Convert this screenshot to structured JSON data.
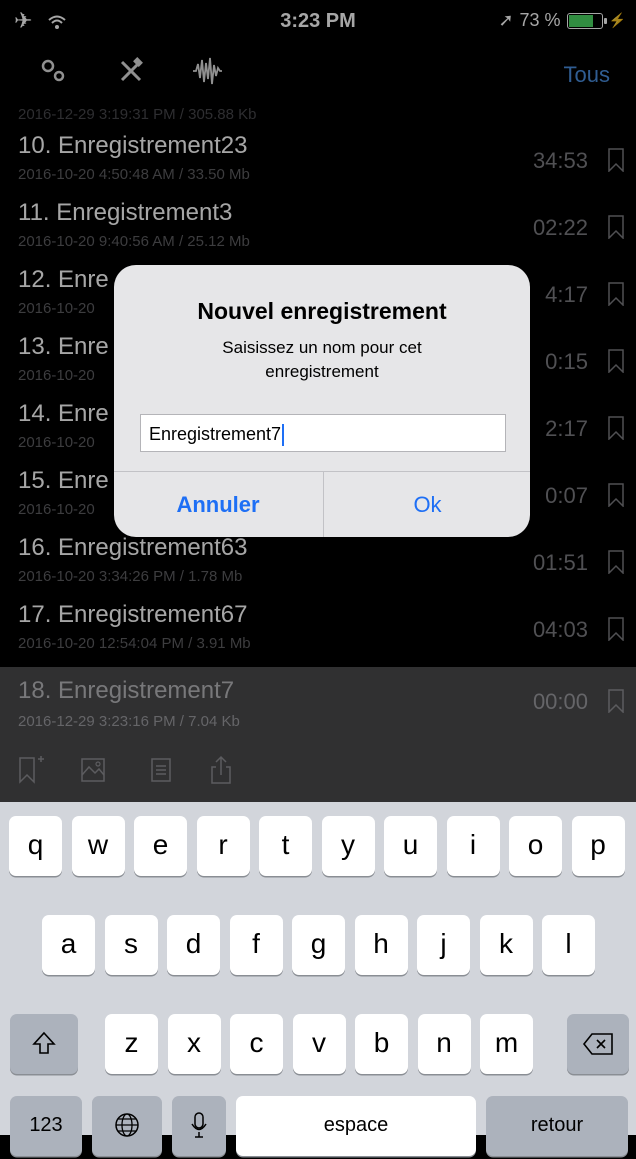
{
  "status_bar": {
    "time": "3:23 PM",
    "battery": "73 %"
  },
  "toolbar": {
    "filter_label": "Tous",
    "icons": [
      "settings-icon",
      "tools-icon",
      "waveform-icon"
    ]
  },
  "list": {
    "partial_meta": "2016-12-29 3:19:31 PM / 305.88 Kb",
    "items": [
      {
        "name": "10. Enregistrement23",
        "meta": "2016-10-20 4:50:48 AM / 33.50 Mb",
        "duration": "34:53"
      },
      {
        "name": "11. Enregistrement3",
        "meta": "2016-10-20 9:40:56 AM / 25.12 Mb",
        "duration": "02:22"
      },
      {
        "name": "12. Enre",
        "meta": "2016-10-20",
        "duration": "4:17"
      },
      {
        "name": "13. Enre",
        "meta": "2016-10-20",
        "duration": "0:15"
      },
      {
        "name": "14. Enre",
        "meta": "2016-10-20",
        "duration": "2:17"
      },
      {
        "name": "15. Enre",
        "meta": "2016-10-20",
        "duration": "0:07"
      },
      {
        "name": "16. Enregistrement63",
        "meta": "2016-10-20 3:34:26 PM / 1.78 Mb",
        "duration": "01:51"
      },
      {
        "name": "17. Enregistrement67",
        "meta": "2016-10-20 12:54:04 PM / 3.91 Mb",
        "duration": "04:03"
      }
    ],
    "selected": {
      "name": "18. Enregistrement7",
      "meta": "2016-12-29 3:23:16 PM / 7.04 Kb",
      "duration": "00:00"
    }
  },
  "dialog": {
    "title": "Nouvel enregistrement",
    "message": "Saisissez un nom pour cet enregistrement",
    "input_value": "Enregistrement7",
    "cancel_label": "Annuler",
    "ok_label": "Ok"
  },
  "keyboard": {
    "row1": [
      "q",
      "w",
      "e",
      "r",
      "t",
      "y",
      "u",
      "i",
      "o",
      "p"
    ],
    "row2": [
      "a",
      "s",
      "d",
      "f",
      "g",
      "h",
      "j",
      "k",
      "l"
    ],
    "row3": [
      "z",
      "x",
      "c",
      "v",
      "b",
      "n",
      "m"
    ],
    "numbers_label": "123",
    "space_label": "espace",
    "return_label": "retour"
  },
  "colors": {
    "accent": "#1e6ff5",
    "filter_link": "#4a8fe0",
    "battery": "#4cd964"
  }
}
